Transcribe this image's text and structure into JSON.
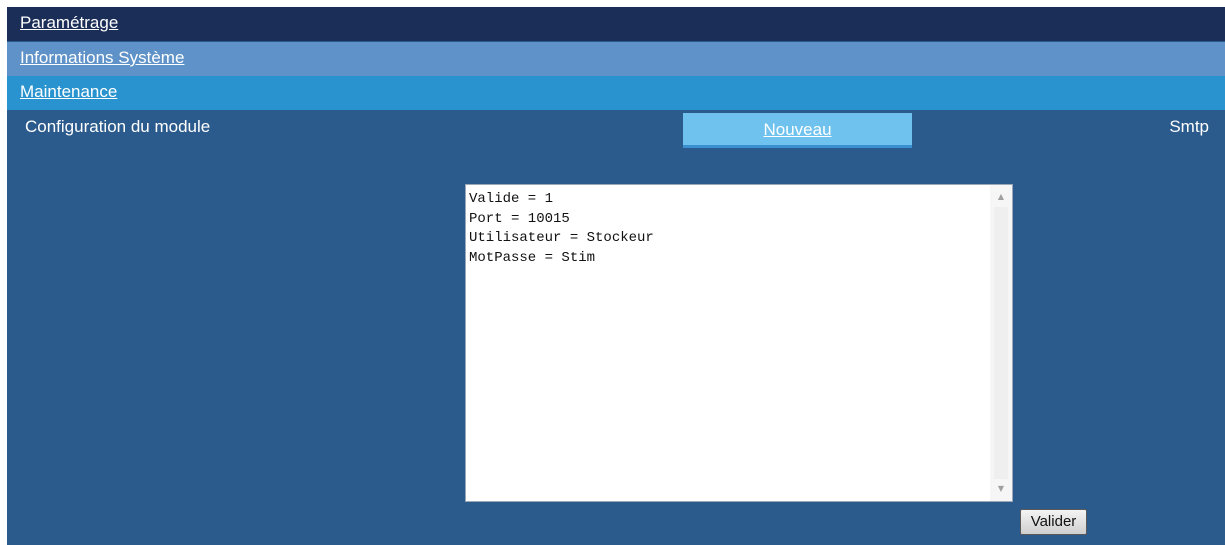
{
  "nav": {
    "parametrage": "Paramétrage",
    "informations": "Informations Système",
    "maintenance": "Maintenance"
  },
  "config": {
    "title": "Configuration du module",
    "new_tab": "Nouveau",
    "module_name": "Smtp"
  },
  "editor": {
    "content": "Valide = 1\nPort = 10015\nUtilisateur = Stockeur\nMotPasse = Stim",
    "scroll_up_icon": "arrow-up-icon",
    "scroll_down_icon": "arrow-down-icon"
  },
  "actions": {
    "submit_label": "Valider"
  },
  "colors": {
    "background": "#2b5b8c",
    "nav_parametrage": "#1b2e58",
    "nav_informations": "#5f92c8",
    "nav_maintenance": "#2893cf",
    "tab_active": "#6fc2ee"
  }
}
